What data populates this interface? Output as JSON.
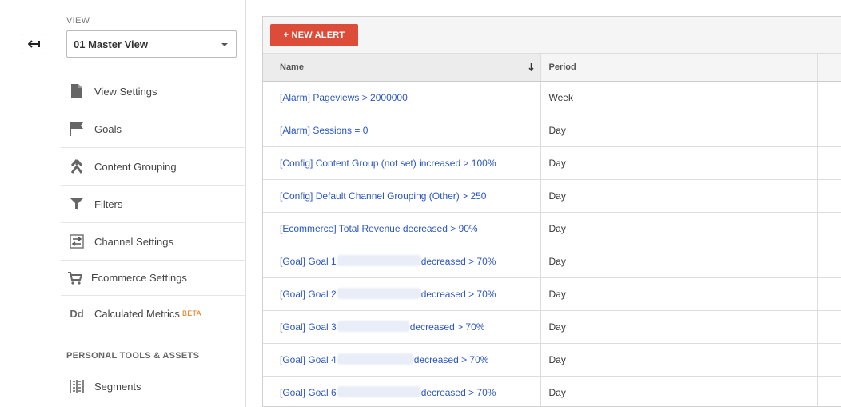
{
  "sidebar": {
    "view_label": "VIEW",
    "view_selected": "01 Master View",
    "items": [
      {
        "label": "View Settings",
        "icon": "document-icon"
      },
      {
        "label": "Goals",
        "icon": "flag-icon"
      },
      {
        "label": "Content Grouping",
        "icon": "content-grouping-icon"
      },
      {
        "label": "Filters",
        "icon": "filter-icon"
      },
      {
        "label": "Channel Settings",
        "icon": "channel-settings-icon"
      },
      {
        "label": "Ecommerce Settings",
        "icon": "cart-icon"
      },
      {
        "label": "Calculated Metrics",
        "icon": "dd-icon",
        "badge": "BETA"
      }
    ],
    "section_label": "PERSONAL TOOLS & ASSETS",
    "segments_label": "Segments",
    "dd_glyph": "Dd"
  },
  "toolbar": {
    "new_alert_label": "+ NEW ALERT"
  },
  "table": {
    "columns": [
      "Name",
      "Period"
    ],
    "rows": [
      {
        "name": "[Alarm] Pageviews > 2000000",
        "period": "Week"
      },
      {
        "name": "[Alarm] Sessions = 0",
        "period": "Day"
      },
      {
        "name": "[Config] Content Group (not set) increased > 100%",
        "period": "Day"
      },
      {
        "name": "[Config] Default Channel Grouping (Other) > 250",
        "period": "Day"
      },
      {
        "name": "[Ecommerce] Total Revenue decreased > 90%",
        "period": "Day"
      },
      {
        "name_prefix": "[Goal] Goal 1",
        "name_suffix": "decreased > 70%",
        "period": "Day"
      },
      {
        "name_prefix": "[Goal] Goal 2",
        "name_suffix": "decreased > 70%",
        "period": "Day"
      },
      {
        "name_prefix": "[Goal] Goal 3",
        "name_suffix": "decreased > 70%",
        "period": "Day"
      },
      {
        "name_prefix": "[Goal] Goal 4",
        "name_suffix": "decreased > 70%",
        "period": "Day"
      },
      {
        "name_prefix": "[Goal] Goal 6",
        "name_suffix": "decreased > 70%",
        "period": "Day"
      }
    ]
  },
  "colors": {
    "accent_red": "#dd4b39",
    "link_blue": "#2a56c6",
    "beta_orange": "#e8710a"
  }
}
